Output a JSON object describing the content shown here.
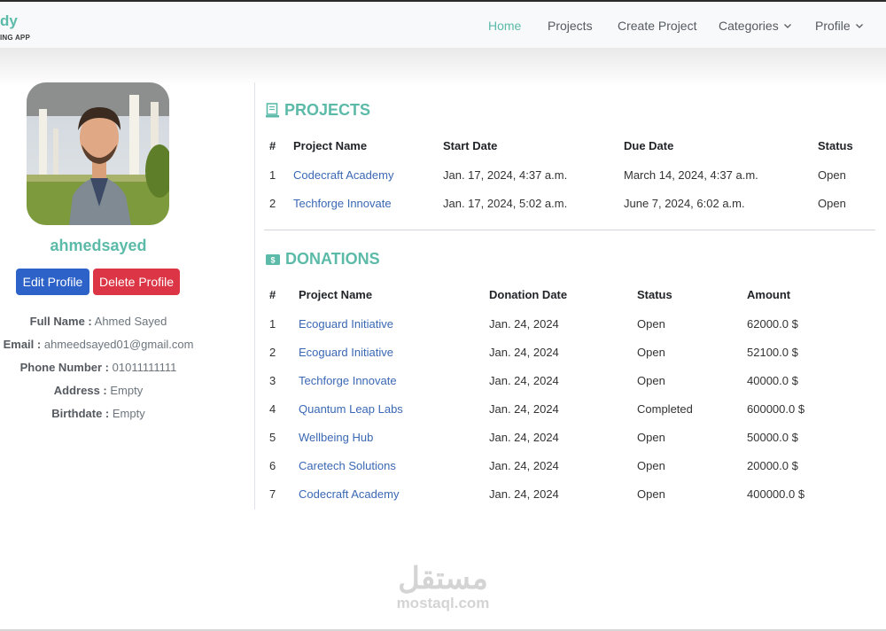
{
  "navbar": {
    "brand_title": "dy",
    "brand_subtitle": "ING APP",
    "links": [
      {
        "label": "Home",
        "active": true
      },
      {
        "label": "Projects"
      },
      {
        "label": "Create Project"
      },
      {
        "label": "Categories",
        "dropdown": true
      },
      {
        "label": "Profile",
        "dropdown": true
      }
    ]
  },
  "profile": {
    "username": "ahmedsayed",
    "edit_label": "Edit Profile",
    "delete_label": "Delete Profile",
    "fields": [
      {
        "key": "Full Name :",
        "value": "Ahmed Sayed"
      },
      {
        "key": "Email :",
        "value": "ahmeedsayed01@gmail.com"
      },
      {
        "key": "Phone Number :",
        "value": "01011111111"
      },
      {
        "key": "Address :",
        "value": "Empty"
      },
      {
        "key": "Birthdate :",
        "value": "Empty"
      }
    ]
  },
  "projects": {
    "title": "PROJECTS",
    "headers": [
      "#",
      "Project Name",
      "Start Date",
      "Due Date",
      "Status"
    ],
    "rows": [
      [
        "1",
        "Codecraft Academy",
        "Jan. 17, 2024, 4:37 a.m.",
        "March 14, 2024, 4:37 a.m.",
        "Open"
      ],
      [
        "2",
        "Techforge Innovate",
        "Jan. 17, 2024, 5:02 a.m.",
        "June 7, 2024, 6:02 a.m.",
        "Open"
      ]
    ]
  },
  "donations": {
    "title": "DONATIONS",
    "headers": [
      "#",
      "Project Name",
      "Donation Date",
      "Status",
      "Amount"
    ],
    "rows": [
      [
        "1",
        "Ecoguard Initiative",
        "Jan. 24, 2024",
        "Open",
        "62000.0 $"
      ],
      [
        "2",
        "Ecoguard Initiative",
        "Jan. 24, 2024",
        "Open",
        "52100.0 $"
      ],
      [
        "3",
        "Techforge Innovate",
        "Jan. 24, 2024",
        "Open",
        "40000.0 $"
      ],
      [
        "4",
        "Quantum Leap Labs",
        "Jan. 24, 2024",
        "Completed",
        "600000.0 $"
      ],
      [
        "5",
        "Wellbeing Hub",
        "Jan. 24, 2024",
        "Open",
        "50000.0 $"
      ],
      [
        "6",
        "Caretech Solutions",
        "Jan. 24, 2024",
        "Open",
        "20000.0 $"
      ],
      [
        "7",
        "Codecraft Academy",
        "Jan. 24, 2024",
        "Open",
        "400000.0 $"
      ]
    ]
  },
  "colors": {
    "accent": "#5bbaa8",
    "link": "#3a68b4",
    "edit_button": "#2d62c8",
    "delete_button": "#dc3545"
  },
  "icons": {
    "projects": "book-icon",
    "donations": "money-icon"
  },
  "watermark": {
    "arabic": "مستقل",
    "latin": "mostaql.com"
  }
}
